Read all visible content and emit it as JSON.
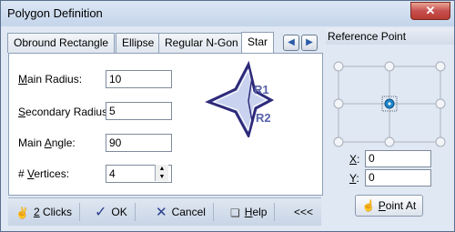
{
  "window": {
    "title": "Polygon Definition",
    "close_label": "✕"
  },
  "tabs": [
    {
      "label": "Obround Rectangle",
      "active": false
    },
    {
      "label": "Ellipse",
      "active": false
    },
    {
      "label": "Regular N-Gon",
      "active": false
    },
    {
      "label": "Star",
      "active": true
    }
  ],
  "tab_nav": {
    "prev": "◀",
    "next": "▶"
  },
  "form": {
    "main_radius": {
      "label_pre": "",
      "label_ul": "M",
      "label_post": "ain Radius:",
      "value": "10"
    },
    "secondary_radius": {
      "label_pre": "",
      "label_ul": "S",
      "label_post": "econdary Radius:",
      "value": "5"
    },
    "main_angle": {
      "label_pre": "Main ",
      "label_ul": "A",
      "label_post": "ngle:",
      "value": "90"
    },
    "vertices": {
      "label_pre": "# ",
      "label_ul": "V",
      "label_post": "ertices:",
      "value": "4"
    }
  },
  "preview": {
    "r1_label": "R1",
    "r2_label": "R2"
  },
  "reference_point": {
    "title": "Reference Point",
    "x_label_ul": "X",
    "x_label_post": ":",
    "x_value": "0",
    "y_label_ul": "Y",
    "y_label_post": ":",
    "y_value": "0",
    "point_at_pre": "",
    "point_at_ul": "P",
    "point_at_post": "oint At"
  },
  "bottom": {
    "two_clicks_ul": "2",
    "two_clicks_post": " Clicks",
    "ok_label": "OK",
    "cancel_label": "Cancel",
    "help_ul": "H",
    "help_post": "elp",
    "collapse_label": "<<<"
  },
  "colors": {
    "star_fill": "#c9d3ef",
    "star_stroke": "#2e2a7a",
    "accent": "#2b5ba8"
  }
}
